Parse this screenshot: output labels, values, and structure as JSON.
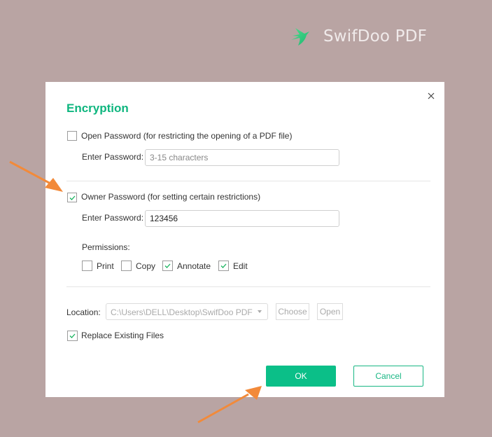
{
  "brand": {
    "name": "SwifDoo PDF",
    "logo_icon": "swallow-bird-icon",
    "logo_color": "#2ecc71"
  },
  "dialog": {
    "title": "Encryption",
    "close_icon": "close-icon",
    "open_password": {
      "label": "Open Password (for restricting the opening of a PDF file)",
      "checked": false,
      "field_label": "Enter Password:",
      "value": "",
      "placeholder": "3-15 characters"
    },
    "owner_password": {
      "label": "Owner Password (for setting certain restrictions)",
      "checked": true,
      "field_label": "Enter Password:",
      "value": "123456"
    },
    "permissions": {
      "label": "Permissions:",
      "items": [
        {
          "label": "Print",
          "checked": false
        },
        {
          "label": "Copy",
          "checked": false
        },
        {
          "label": "Annotate",
          "checked": true
        },
        {
          "label": "Edit",
          "checked": true
        }
      ]
    },
    "location": {
      "label": "Location:",
      "value": "C:\\Users\\DELL\\Desktop\\SwifDoo PDF",
      "choose_label": "Choose",
      "open_label": "Open"
    },
    "replace_existing": {
      "label": "Replace Existing Files",
      "checked": true
    },
    "ok_label": "OK",
    "cancel_label": "Cancel"
  },
  "colors": {
    "accent": "#0bbf88",
    "title": "#0fb67f",
    "background": "#b9a4a3",
    "annotation_arrow": "#f28a3a"
  },
  "annotations": [
    "arrow-pointing-owner-password",
    "arrow-pointing-ok-button"
  ]
}
